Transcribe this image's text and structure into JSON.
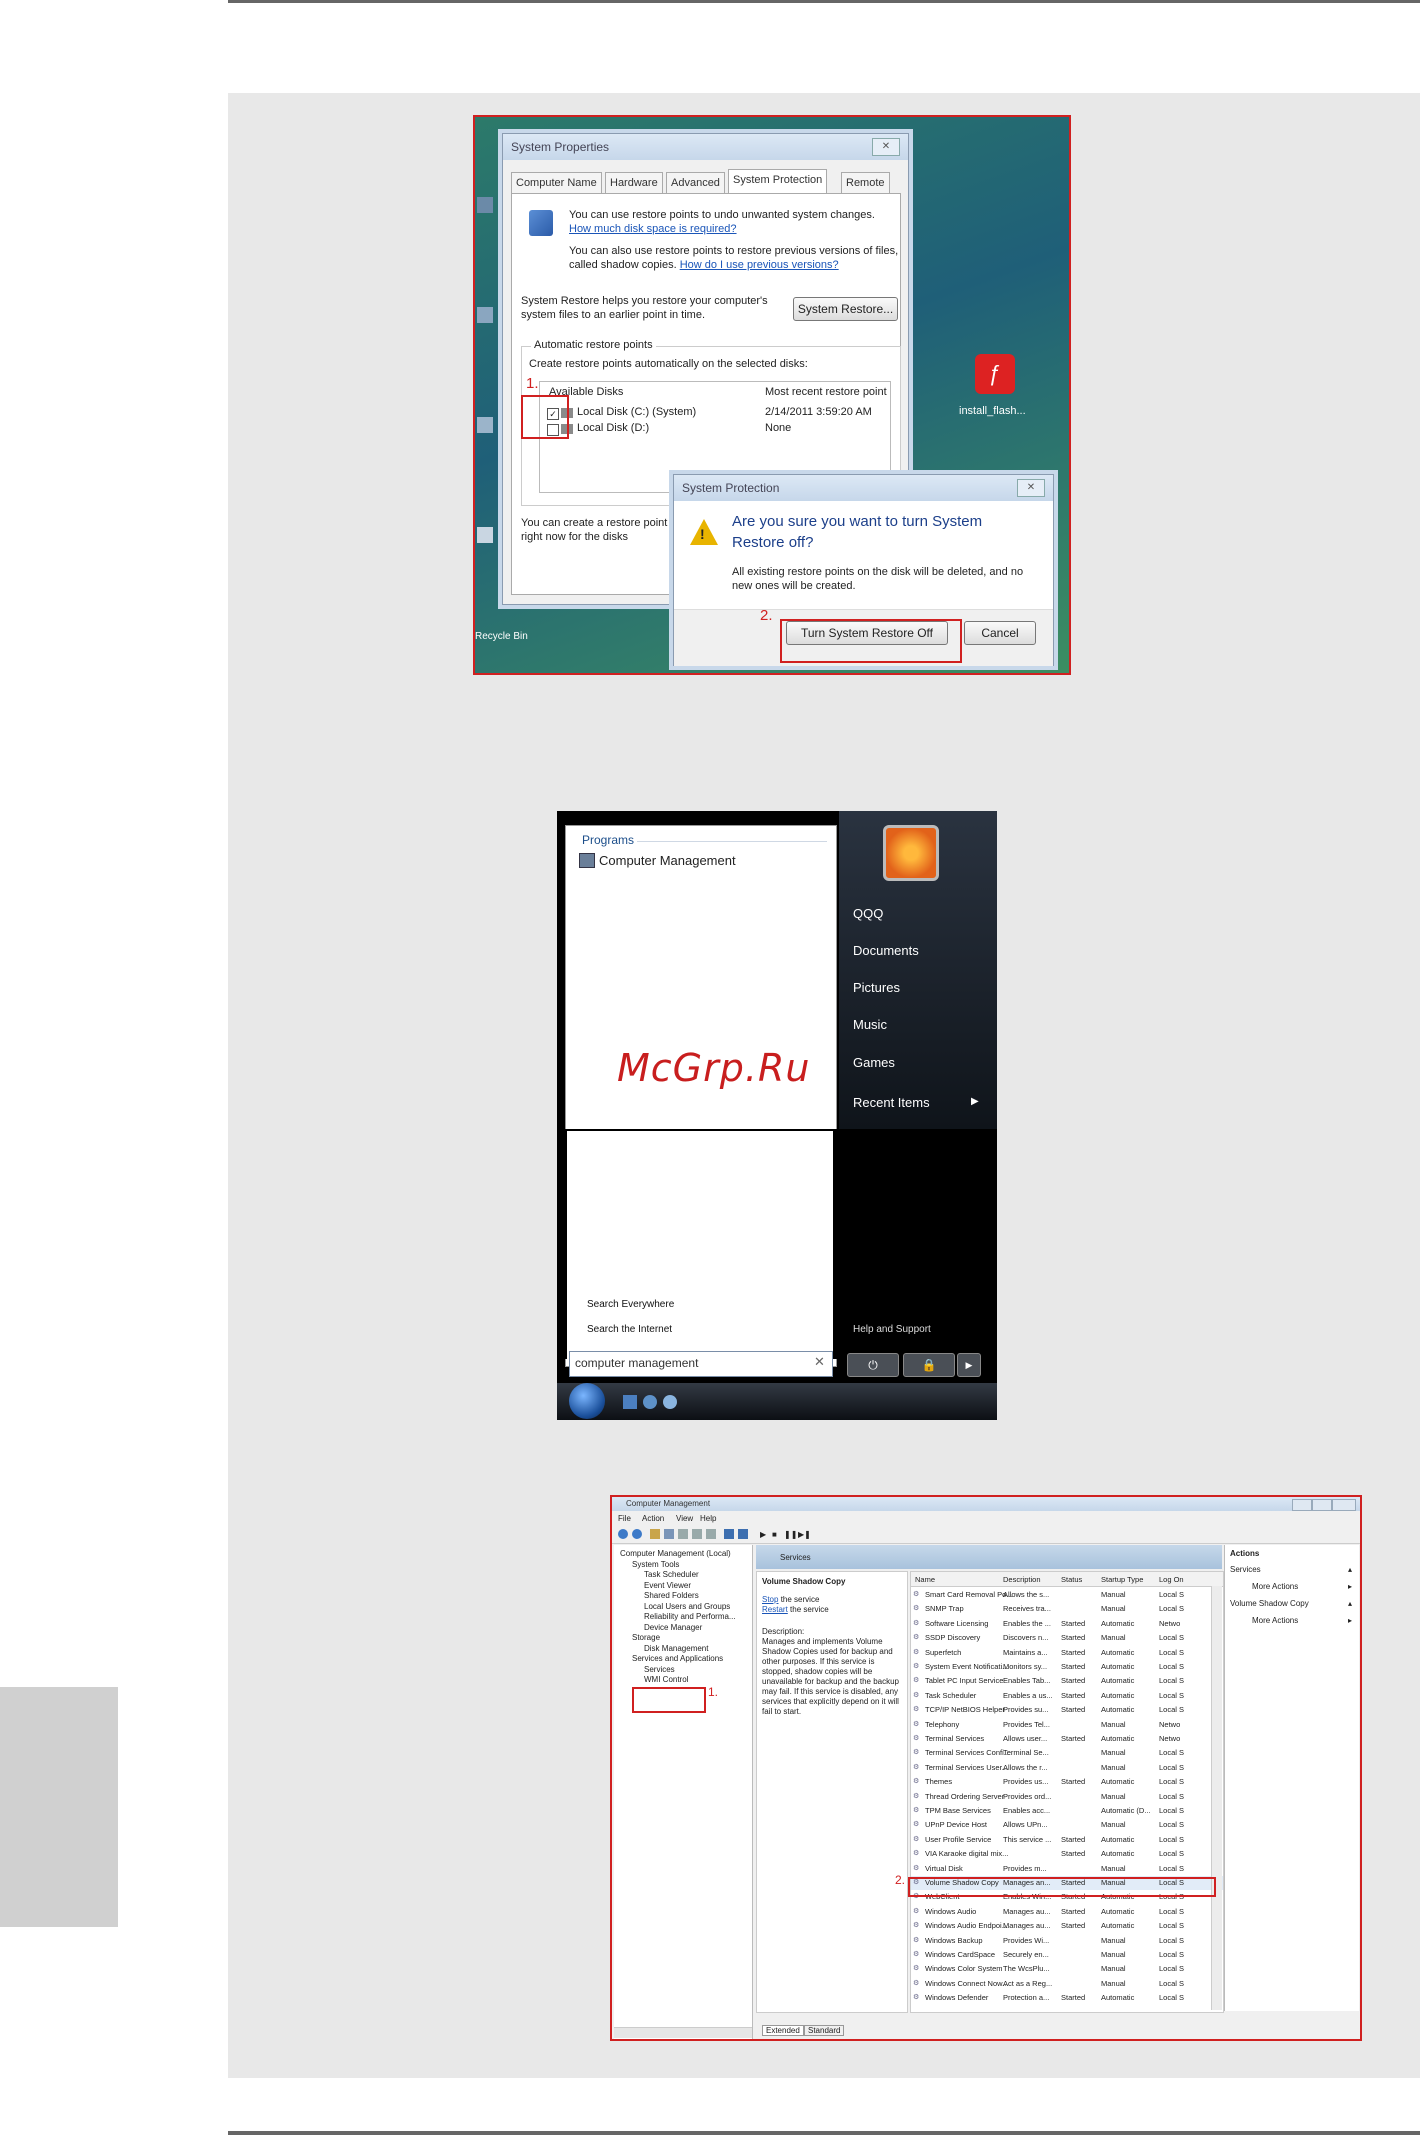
{
  "watermark": "McGrp.Ru",
  "system_properties": {
    "title": "System Properties",
    "tabs": [
      "Computer Name",
      "Hardware",
      "Advanced",
      "System Protection",
      "Remote"
    ],
    "line1": "You can use restore points to undo unwanted system changes.",
    "link1": "How much disk space is required?",
    "line2": "You can also use restore points to restore previous versions of files, called shadow copies.",
    "link2": "How do I use previous versions?",
    "restore_text": "System Restore helps you restore your computer's system files to an earlier point in time.",
    "restore_button": "System Restore...",
    "group_label": "Automatic restore points",
    "group_desc": "Create restore points automatically on the selected disks:",
    "col_disks": "Available Disks",
    "col_recent": "Most recent restore point",
    "disks": [
      {
        "name": "Local Disk (C:) (System)",
        "recent": "2/14/2011 3:59:20 AM"
      },
      {
        "name": "Local Disk (D:)",
        "recent": "None"
      }
    ],
    "bottom_text": "You can create a restore point right now for the disks selected above.",
    "step1": "1.",
    "step2": "2."
  },
  "protection_dialog": {
    "title": "System Protection",
    "question": "Are you sure you want to turn System Restore off?",
    "detail": "All existing restore points on the disk will be deleted, and no new ones will be created.",
    "confirm_button": "Turn System Restore Off",
    "cancel_button": "Cancel"
  },
  "desktop": {
    "icon_label": "install_flash...",
    "recycle_label": "Recycle Bin"
  },
  "start_menu": {
    "programs_header": "Programs",
    "program_result": "Computer Management",
    "right_items": [
      "QQQ",
      "Documents",
      "Pictures",
      "Music",
      "Games",
      "Recent Items"
    ],
    "search_everywhere": "Search Everywhere",
    "search_internet": "Search the Internet",
    "help_item": "Help and Support",
    "search_value": "computer management"
  },
  "computer_management": {
    "title": "Computer Management",
    "menu": [
      "File",
      "Action",
      "View",
      "Help"
    ],
    "tree": [
      {
        "label": "Computer Management (Local)",
        "level": 0
      },
      {
        "label": "System Tools",
        "level": 1
      },
      {
        "label": "Task Scheduler",
        "level": 2
      },
      {
        "label": "Event Viewer",
        "level": 2
      },
      {
        "label": "Shared Folders",
        "level": 2
      },
      {
        "label": "Local Users and Groups",
        "level": 2
      },
      {
        "label": "Reliability and Performa...",
        "level": 2
      },
      {
        "label": "Device Manager",
        "level": 2
      },
      {
        "label": "Storage",
        "level": 1
      },
      {
        "label": "Disk Management",
        "level": 2
      },
      {
        "label": "Services and Applications",
        "level": 1
      },
      {
        "label": "Services",
        "level": 2
      },
      {
        "label": "WMI Control",
        "level": 2
      }
    ],
    "panel_header": "Services",
    "selected_service": "Volume Shadow Copy",
    "stop_link": "Stop",
    "stop_text": "the service",
    "restart_link": "Restart",
    "restart_text": "the service",
    "description_label": "Description:",
    "description": "Manages and implements Volume Shadow Copies used for backup and other purposes. If this service is stopped, shadow copies will be unavailable for backup and the backup may fail. If this service is disabled, any services that explicitly depend on it will fail to start.",
    "columns": [
      "Name",
      "Description",
      "Status",
      "Startup Type",
      "Log On"
    ],
    "rows": [
      [
        "Smart Card Removal Po...",
        "Allows the s...",
        "",
        "Manual",
        "Local S"
      ],
      [
        "SNMP Trap",
        "Receives tra...",
        "",
        "Manual",
        "Local S"
      ],
      [
        "Software Licensing",
        "Enables the ...",
        "Started",
        "Automatic",
        "Netwo"
      ],
      [
        "SSDP Discovery",
        "Discovers n...",
        "Started",
        "Manual",
        "Local S"
      ],
      [
        "Superfetch",
        "Maintains a...",
        "Started",
        "Automatic",
        "Local S"
      ],
      [
        "System Event Notificati...",
        "Monitors sy...",
        "Started",
        "Automatic",
        "Local S"
      ],
      [
        "Tablet PC Input Service",
        "Enables Tab...",
        "Started",
        "Automatic",
        "Local S"
      ],
      [
        "Task Scheduler",
        "Enables a us...",
        "Started",
        "Automatic",
        "Local S"
      ],
      [
        "TCP/IP NetBIOS Helper",
        "Provides su...",
        "Started",
        "Automatic",
        "Local S"
      ],
      [
        "Telephony",
        "Provides Tel...",
        "",
        "Manual",
        "Netwo"
      ],
      [
        "Terminal Services",
        "Allows user...",
        "Started",
        "Automatic",
        "Netwo"
      ],
      [
        "Terminal Services Confi...",
        "Terminal Se...",
        "",
        "Manual",
        "Local S"
      ],
      [
        "Terminal Services User...",
        "Allows the r...",
        "",
        "Manual",
        "Local S"
      ],
      [
        "Themes",
        "Provides us...",
        "Started",
        "Automatic",
        "Local S"
      ],
      [
        "Thread Ordering Server",
        "Provides ord...",
        "",
        "Manual",
        "Local S"
      ],
      [
        "TPM Base Services",
        "Enables acc...",
        "",
        "Automatic (D...",
        "Local S"
      ],
      [
        "UPnP Device Host",
        "Allows UPn...",
        "",
        "Manual",
        "Local S"
      ],
      [
        "User Profile Service",
        "This service ...",
        "Started",
        "Automatic",
        "Local S"
      ],
      [
        "VIA Karaoke digital mix...",
        "",
        "Started",
        "Automatic",
        "Local S"
      ],
      [
        "Virtual Disk",
        "Provides m...",
        "",
        "Manual",
        "Local S"
      ],
      [
        "Volume Shadow Copy",
        "Manages an...",
        "Started",
        "Manual",
        "Local S"
      ],
      [
        "WebClient",
        "Enables Win...",
        "Started",
        "Automatic",
        "Local S"
      ],
      [
        "Windows Audio",
        "Manages au...",
        "Started",
        "Automatic",
        "Local S"
      ],
      [
        "Windows Audio Endpoi...",
        "Manages au...",
        "Started",
        "Automatic",
        "Local S"
      ],
      [
        "Windows Backup",
        "Provides Wi...",
        "",
        "Manual",
        "Local S"
      ],
      [
        "Windows CardSpace",
        "Securely en...",
        "",
        "Manual",
        "Local S"
      ],
      [
        "Windows Color System",
        "The WcsPlu...",
        "",
        "Manual",
        "Local S"
      ],
      [
        "Windows Connect Now...",
        "Act as a Reg...",
        "",
        "Manual",
        "Local S"
      ],
      [
        "Windows Defender",
        "Protection a...",
        "Started",
        "Automatic",
        "Local S"
      ]
    ],
    "actions_header": "Actions",
    "actions": [
      {
        "label": "Services",
        "sub": false
      },
      {
        "label": "More Actions",
        "sub": true
      },
      {
        "label": "Volume Shadow Copy",
        "sub": false
      },
      {
        "label": "More Actions",
        "sub": true
      }
    ],
    "bottom_tabs": [
      "Extended",
      "Standard"
    ],
    "step1": "1.",
    "step2": "2."
  }
}
